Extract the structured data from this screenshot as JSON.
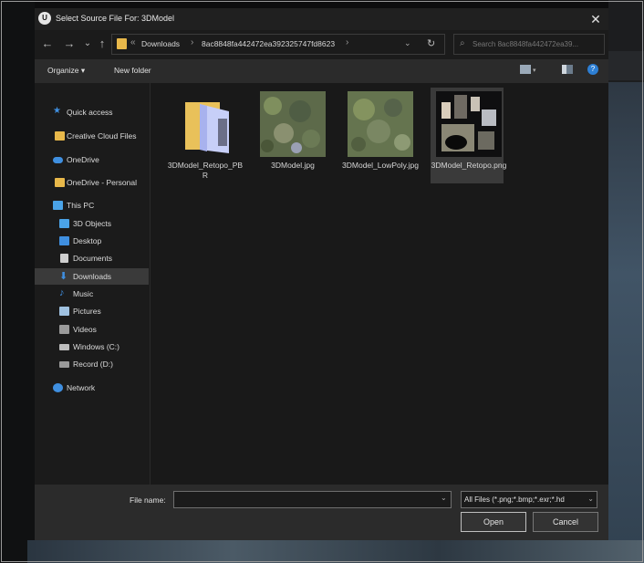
{
  "window": {
    "title": "Select  Source File For: 3DModel",
    "logo_text": "U"
  },
  "nav": {
    "back_icon": "←",
    "forward_icon": "→",
    "recent_icon": "⌄",
    "up_icon": "↑"
  },
  "address": {
    "overflow": "«",
    "segments": [
      "Downloads",
      "8ac8848fa442472ea392325747fd8623"
    ],
    "separator": "›",
    "dropdown_icon": "⌄",
    "refresh_icon": "↻"
  },
  "search": {
    "placeholder": "Search 8ac8848fa442472ea39...",
    "icon": "⌕"
  },
  "toolbar": {
    "organize_label": "Organize ▾",
    "new_folder_label": "New folder",
    "help_icon": "?"
  },
  "sidebar": {
    "items": [
      {
        "label": "Quick access",
        "icon": "star-icon",
        "color": "#3f8fe0"
      },
      {
        "label": "Creative Cloud Files",
        "icon": "cc-folder-icon",
        "color": "#e8b84a"
      },
      {
        "label": "OneDrive",
        "icon": "cloud-icon",
        "color": "#3f8fe0"
      },
      {
        "label": "OneDrive - Personal",
        "icon": "folder-icon",
        "color": "#e8b84a"
      },
      {
        "label": "This PC",
        "icon": "pc-icon",
        "color": "#4aa3e8"
      },
      {
        "label": "3D Objects",
        "icon": "cube-icon",
        "color": "#4aa3e8"
      },
      {
        "label": "Desktop",
        "icon": "desktop-icon",
        "color": "#3f8fe0"
      },
      {
        "label": "Documents",
        "icon": "document-icon",
        "color": "#cfcfcf"
      },
      {
        "label": "Downloads",
        "icon": "download-icon",
        "color": "#3f8fe0"
      },
      {
        "label": "Music",
        "icon": "music-icon",
        "color": "#3f8fe0"
      },
      {
        "label": "Pictures",
        "icon": "pictures-icon",
        "color": "#9fc1e0"
      },
      {
        "label": "Videos",
        "icon": "video-icon",
        "color": "#9a9a9a"
      },
      {
        "label": "Windows (C:)",
        "icon": "drive-icon",
        "color": "#bdbdbd"
      },
      {
        "label": "Record (D:)",
        "icon": "drive-icon",
        "color": "#9a9a9a"
      },
      {
        "label": "Network",
        "icon": "network-icon",
        "color": "#3f8fe0"
      }
    ],
    "selected": "Downloads"
  },
  "files": [
    {
      "name": "3DModel_Retopo_PBR",
      "type": "folder"
    },
    {
      "name": "3DModel.jpg",
      "type": "image"
    },
    {
      "name": "3DModel_LowPoly.jpg",
      "type": "image"
    },
    {
      "name": "3DModel_Retopo.png",
      "type": "image",
      "selected": true
    }
  ],
  "footer": {
    "filename_label": "File name:",
    "filename_value": "",
    "filetype_value": "All Files (*.png;*.bmp;*.exr;*.hd",
    "open_label": "Open",
    "cancel_label": "Cancel",
    "dropdown_icon": "⌄"
  },
  "close_icon": "✕"
}
